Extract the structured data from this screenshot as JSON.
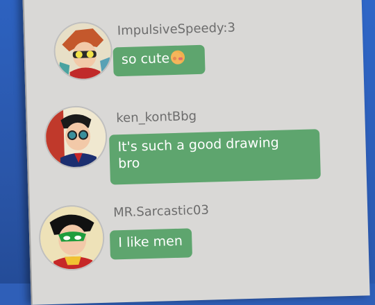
{
  "messages": [
    {
      "username": "ImpulsiveSpeedy:3",
      "text": "so cute",
      "emoji": "smiling-face-with-hands-emoji",
      "avatar": "impulsive-speedy-avatar"
    },
    {
      "username": "ken_kontBbg",
      "text_line1": "It's such a good drawing",
      "text_line2": "bro",
      "avatar": "ken-kont-avatar"
    },
    {
      "username": "MR.Sarcastic03",
      "text": "I like men",
      "avatar": "mr-sarcastic-avatar"
    }
  ],
  "colors": {
    "bubble": "#5ea56e",
    "screen": "#d9d8d6",
    "background": "#2f5fb8",
    "username": "#6c6c6c"
  }
}
